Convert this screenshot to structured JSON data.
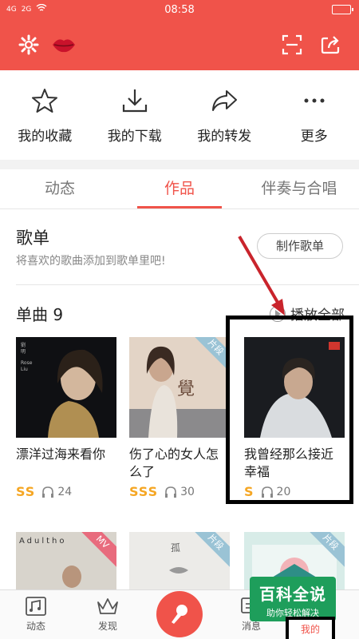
{
  "status_bar": {
    "signal_1": "4G",
    "signal_2": "2G",
    "time": "08:58"
  },
  "header": {
    "icons": [
      "gear-icon",
      "lips-logo-icon",
      "scan-icon",
      "share-icon"
    ],
    "accent": "#f0534a"
  },
  "quick_actions": [
    {
      "label": "我的收藏",
      "icon": "star-icon"
    },
    {
      "label": "我的下载",
      "icon": "download-icon"
    },
    {
      "label": "我的转发",
      "icon": "forward-icon"
    },
    {
      "label": "更多",
      "icon": "more-icon"
    }
  ],
  "tabs": [
    {
      "label": "动态",
      "active": false
    },
    {
      "label": "作品",
      "active": true
    },
    {
      "label": "伴奏与合唱",
      "active": false
    }
  ],
  "playlist": {
    "title": "歌单",
    "subtitle": "将喜欢的歌曲添加到歌单里吧!",
    "make_button": "制作歌单"
  },
  "singles": {
    "title": "单曲 9",
    "play_all": "播放全部"
  },
  "songs": [
    {
      "title": "漂洋过海来看你",
      "badge": "SS",
      "plays": "24",
      "corner": ""
    },
    {
      "title": "伤了心的女人怎么了",
      "badge": "SSS",
      "plays": "30",
      "corner": "片段"
    },
    {
      "title": "我曾经那么接近幸福",
      "badge": "S",
      "plays": "20",
      "corner": ""
    },
    {
      "title": "",
      "badge": "",
      "plays": "",
      "corner": "MV"
    },
    {
      "title": "",
      "badge": "",
      "plays": "",
      "corner": "片段"
    },
    {
      "title": "",
      "badge": "",
      "plays": "",
      "corner": "片段"
    }
  ],
  "bottom_nav": [
    {
      "label": "动态",
      "icon": "feed-icon"
    },
    {
      "label": "发现",
      "icon": "crown-icon"
    },
    {
      "label": "",
      "icon": "microphone-icon"
    },
    {
      "label": "消息",
      "icon": "message-icon"
    },
    {
      "label": "我的",
      "icon": "profile-icon"
    }
  ],
  "watermark": {
    "line1": "百科全说",
    "line2": "助你轻松解决"
  }
}
